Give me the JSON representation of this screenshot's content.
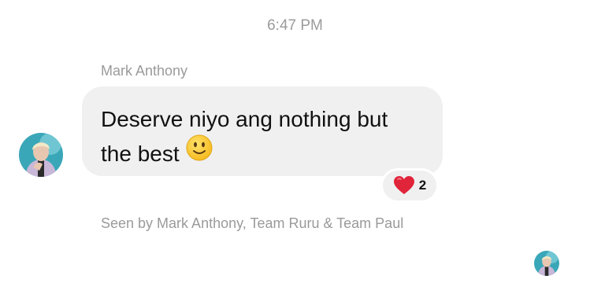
{
  "conversation": {
    "timestamp": "6:47 PM",
    "message": {
      "sender": "Mark Anthony",
      "text_line_1": "Deserve niyo ang nothing but",
      "text_line_2": "the best",
      "emoji_icon": "slightly-smiling-face-emoji",
      "reaction": {
        "icon": "red-heart-emoji",
        "count": "2"
      }
    },
    "seen_by": "Seen by Mark Anthony, Team Ruru & Team Paul"
  },
  "colors": {
    "background": "#ffffff",
    "bubble": "#f0f0f0",
    "meta_text": "#9a9a9a",
    "message_text": "#111111",
    "heart": "#e0243a"
  }
}
